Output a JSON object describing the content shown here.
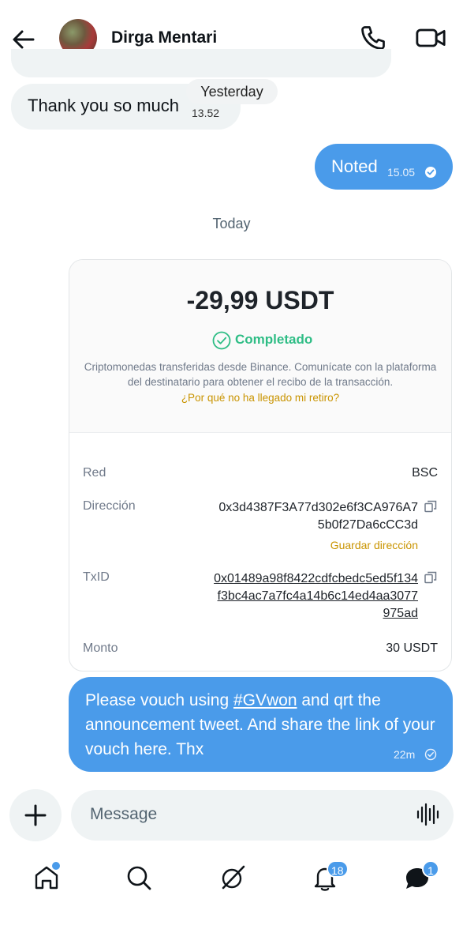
{
  "header": {
    "contact_name": "Dirga Mentari",
    "back_icon": "arrow-left-icon",
    "call_icon": "phone-icon",
    "video_icon": "video-icon"
  },
  "messages": {
    "thanks": {
      "text": "Thank you so much",
      "time": "13.52"
    },
    "yesterday_label": "Yesterday",
    "noted": {
      "text": "Noted",
      "time": "15.05"
    },
    "today_label": "Today"
  },
  "card": {
    "amount": "-29,99 USDT",
    "status": "Completado",
    "description": "Criptomonedas transferidas desde Binance. Comunícate con la plataforma del destinatario para obtener el recibo de la transacción.",
    "help_link": "¿Por qué no ha llegado mi retiro?",
    "rows": {
      "network_label": "Red",
      "network_value": "BSC",
      "address_label": "Dirección",
      "address_value": "0x3d4387F3A77d302e6f3CA976A75b0f27Da6cCC3d",
      "save_address": "Guardar dirección",
      "txid_label": "TxID",
      "txid_value": "0x01489a98f8422cdfcbedc5ed5f134f3bc4ac7a7fc4a14b6c14ed4aa3077975ad",
      "amount_label": "Monto",
      "amount_value": "30 USDT"
    }
  },
  "vouch": {
    "prefix": "Please vouch using ",
    "hashtag": "#GVwon",
    "suffix": " and qrt the announcement tweet. And share the link of your vouch here. Thx",
    "time": "22m"
  },
  "composer": {
    "placeholder": "Message"
  },
  "nav": {
    "notifications_badge": "18",
    "messages_badge": "1"
  },
  "colors": {
    "accent": "#4a9bea",
    "success": "#2ebd85",
    "link_gold": "#c99400"
  }
}
